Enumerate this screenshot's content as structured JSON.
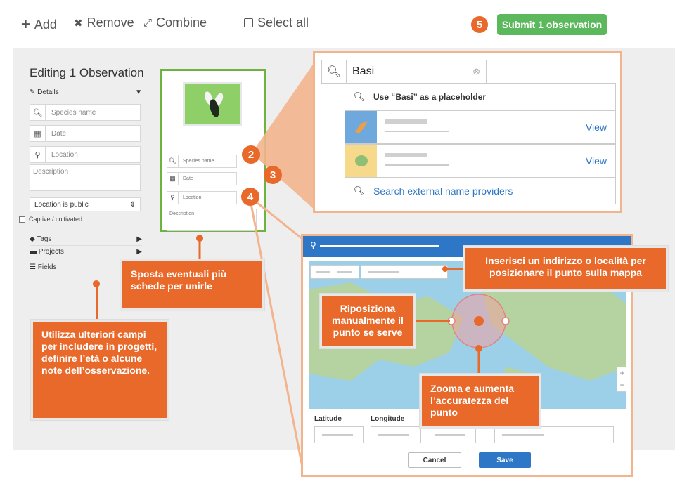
{
  "toolbar": {
    "add_label": "Add",
    "remove_label": "Remove",
    "combine_label": "Combine",
    "select_all_label": "Select all",
    "step_5": "5",
    "submit_label": "Submit 1 observation",
    "colors": {
      "submit": "#5bb85c",
      "step_badge": "#e8692a"
    }
  },
  "left_panel": {
    "title": "Editing 1 Observation",
    "details_label": "Details",
    "species_placeholder": "Species name",
    "date_placeholder": "Date",
    "location_placeholder": "Location",
    "description_placeholder": "Description",
    "location_visibility": "Location is public",
    "captive_label": "Captive / cultivated",
    "tags_label": "Tags",
    "projects_label": "Projects",
    "fields_label": "Fields"
  },
  "card": {
    "species_placeholder": "Species name",
    "date_placeholder": "Date",
    "location_placeholder": "Location",
    "description_placeholder": "Description",
    "step_2": "2",
    "step_3": "3",
    "step_4": "4"
  },
  "callouts": {
    "fields": "Utilizza ulteriori campi per includere in progetti, definire l’età o alcune note dell’osservazione.",
    "move_cards": "Sposta eventuali più schede per unirle",
    "address": "Inserisci un indirizzo o località per posizionare il punto sulla mappa",
    "reposition": "Riposiziona manualmente il punto se serve",
    "zoom": "Zooma e aumenta l’accuratezza del punto"
  },
  "search_popup": {
    "query": "Basi",
    "placeholder_option": "Use “Basi” as a placeholder",
    "result_1_action": "View",
    "result_2_action": "View",
    "external_label": "Search external name providers"
  },
  "map_modal": {
    "latitude_label": "Latitude",
    "longitude_label": "Longitude",
    "cancel_label": "Cancel",
    "save_label": "Save",
    "colors": {
      "header": "#2e77c6",
      "water": "#9ccfe8",
      "land": "#b5d3a0"
    }
  }
}
